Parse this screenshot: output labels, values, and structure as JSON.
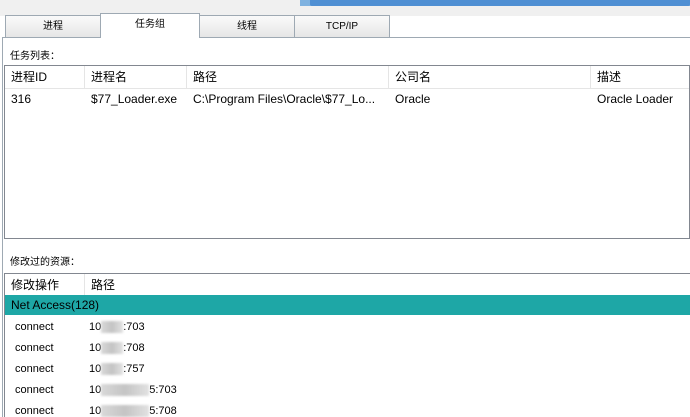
{
  "tabs": [
    {
      "label": "进程"
    },
    {
      "label": "任务组",
      "active": true
    },
    {
      "label": "线程"
    },
    {
      "label": "TCP/IP"
    }
  ],
  "task_list": {
    "label": "任务列表：",
    "columns": [
      "进程ID",
      "进程名",
      "路径",
      "公司名",
      "描述"
    ],
    "rows": [
      {
        "pid": "316",
        "name": "$77_Loader.exe",
        "path": "C:\\Program Files\\Oracle\\$77_Lo...",
        "company": "Oracle",
        "desc": "Oracle Loader"
      }
    ]
  },
  "modified": {
    "label": "修改过的资源：",
    "columns": [
      "修改操作",
      "路径"
    ],
    "group": "Net Access(128)",
    "rows": [
      {
        "op": "connect",
        "prefix": "10",
        "suffix": ":703"
      },
      {
        "op": "connect",
        "prefix": "10",
        "suffix": ":708"
      },
      {
        "op": "connect",
        "prefix": "10",
        "suffix": ":757"
      },
      {
        "op": "connect",
        "prefix": "10",
        "suffix": "5:703"
      },
      {
        "op": "connect",
        "prefix": "10",
        "suffix": "5:708"
      }
    ]
  },
  "colors": {
    "group_bg": "#1ea7a6",
    "border": "#828790"
  }
}
